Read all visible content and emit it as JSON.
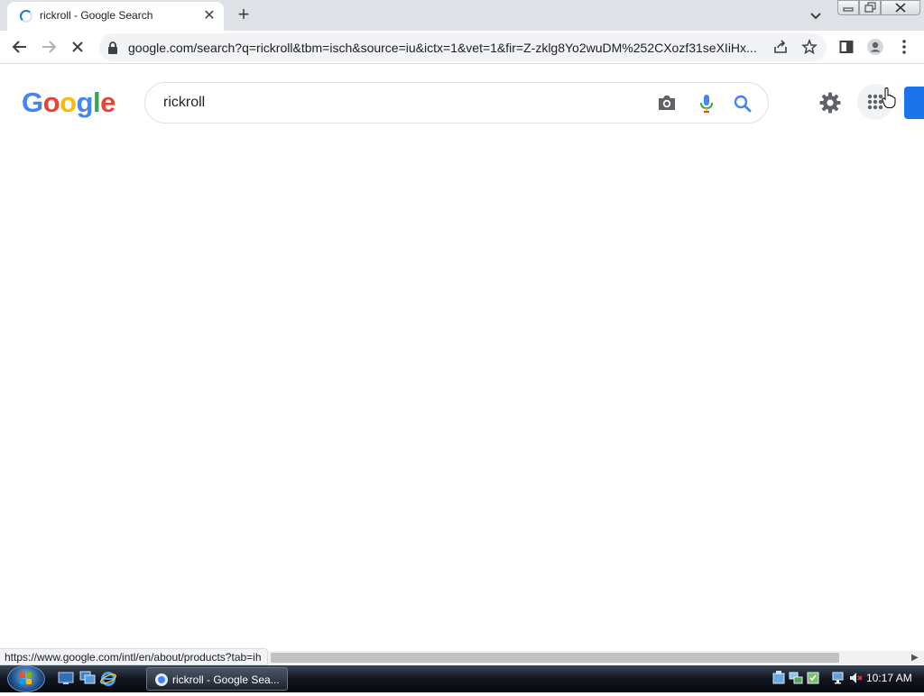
{
  "browser": {
    "tab": {
      "title": "rickroll - Google Search"
    },
    "new_tab_symbol": "+",
    "tab_close_symbol": "✕",
    "url": "google.com/search?q=rickroll&tbm=isch&source=iu&ictx=1&vet=1&fir=Z-zklg8Yo2wuDM%252CXozf31seXIiHx..."
  },
  "google": {
    "logo": [
      "G",
      "o",
      "o",
      "g",
      "l",
      "e"
    ],
    "logo_colors": [
      "#4285f4",
      "#ea4335",
      "#fbbc05",
      "#4285f4",
      "#34a853",
      "#ea4335"
    ],
    "search_query": "rickroll"
  },
  "status_bar": {
    "url": "https://www.google.com/intl/en/about/products?tab=ih"
  },
  "taskbar": {
    "window_label": "rickroll - Google Sea...",
    "clock": "10:17 AM"
  },
  "colors": {
    "accent": "#1a73e8"
  }
}
